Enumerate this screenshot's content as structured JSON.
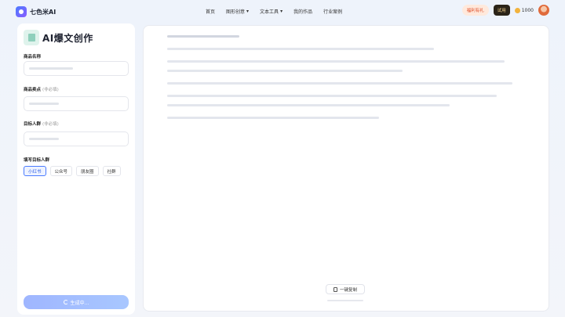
{
  "app": {
    "logo_text": "七色米AI"
  },
  "nav": {
    "items": [
      {
        "label": "首页"
      },
      {
        "label": "图形创意",
        "has_menu": true
      },
      {
        "label": "文本工具",
        "has_menu": true
      },
      {
        "label": "我的作品"
      },
      {
        "label": "行业案例"
      }
    ]
  },
  "header_tools": {
    "promo_label": "福利有礼",
    "vip_label": "试用",
    "points": "1000"
  },
  "form": {
    "title": "AI爆文创作",
    "product_name_label": "商品名称",
    "product_name_value": "",
    "selling_points_label": "商品卖点",
    "selling_points_hint": "(非必填)",
    "selling_points_value": "",
    "audience_label": "目标人群",
    "audience_hint": "(非必填)",
    "audience_value": "",
    "platform_label": "填写目标人群",
    "platforms": [
      {
        "label": "小红书",
        "active": true
      },
      {
        "label": "公众号",
        "active": false
      },
      {
        "label": "朋友圈",
        "active": false
      },
      {
        "label": "社群",
        "active": false
      }
    ],
    "generate_label": "生成中..."
  },
  "result": {
    "copy_label": "一键复制"
  },
  "colors": {
    "accent": "#4b7bff"
  }
}
